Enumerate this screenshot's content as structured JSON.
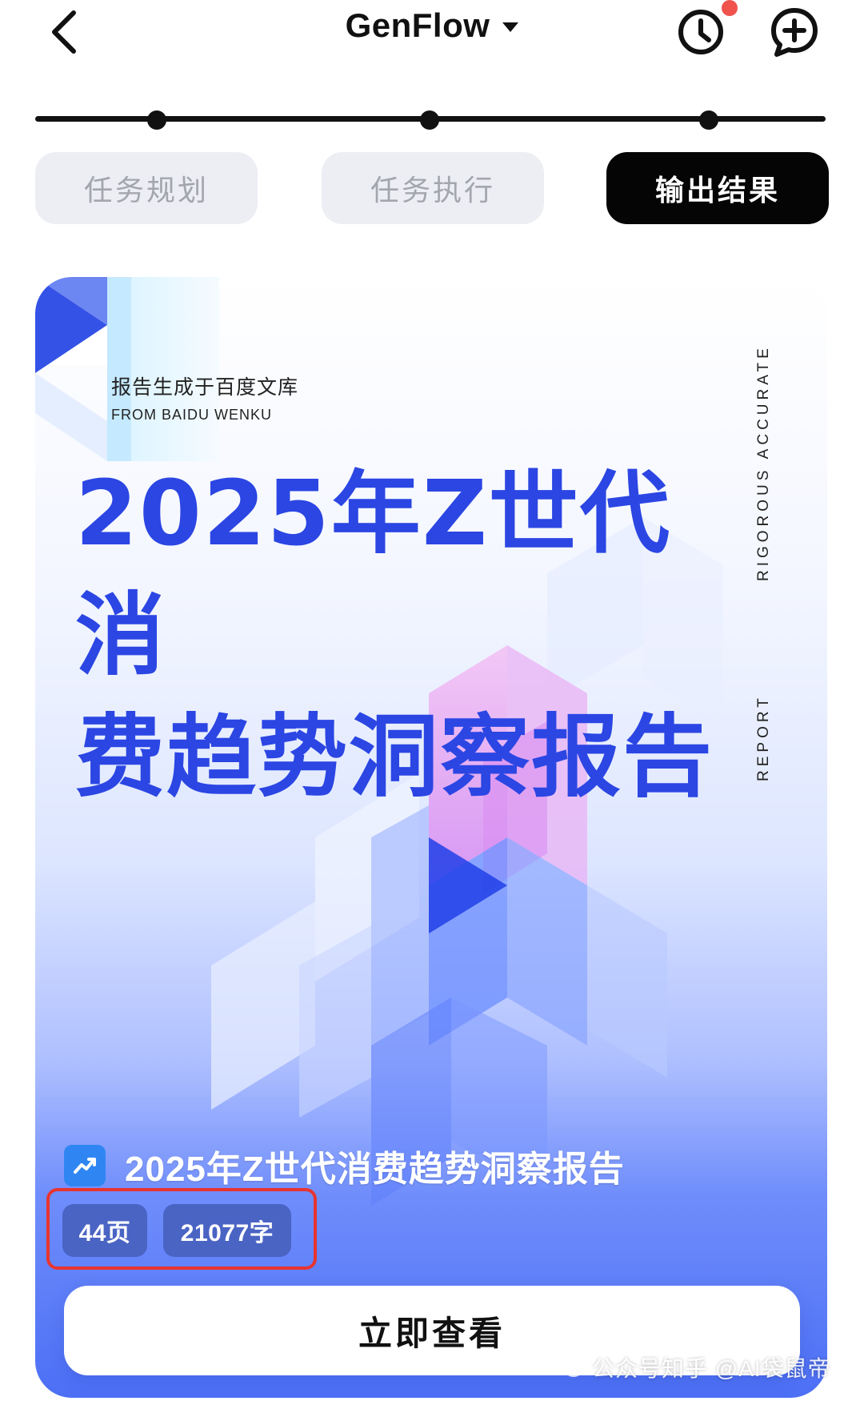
{
  "header": {
    "app_title": "GenFlow",
    "icons": [
      "back-icon",
      "caret-down-icon",
      "history-icon",
      "new-chat-icon"
    ],
    "history_notification_color": "#f0524e"
  },
  "steps": [
    {
      "label": "任务规划",
      "state": "done"
    },
    {
      "label": "任务执行",
      "state": "done"
    },
    {
      "label": "输出结果",
      "state": "active"
    }
  ],
  "report_card": {
    "source_cn": "报告生成于百度文库",
    "source_en": "FROM BAIDU WENKU",
    "title_line1": "2025年Z世代消",
    "title_line2": "费趋势洞察报告",
    "side_tag_1": "RIGOROUS ACCURATE",
    "side_tag_2": "REPORT",
    "report_name": "2025年Z世代消费趋势洞察报告",
    "report_icon": "trend-chart-icon",
    "pages": "44页",
    "words": "21077字",
    "view_button": "立即查看",
    "accent_color": "#2b46e3",
    "highlight_box_color": "#e8342f"
  },
  "watermark": {
    "text": "公众号知乎 @AI袋鼠帝",
    "icon": "wechat-icon"
  }
}
